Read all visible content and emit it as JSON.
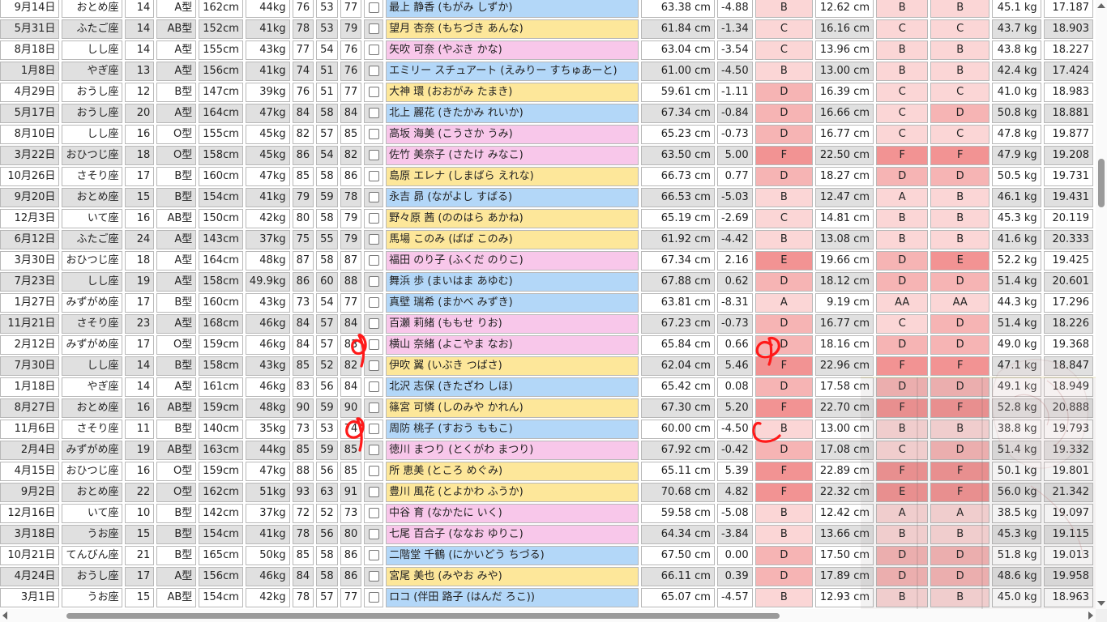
{
  "grid": {
    "rows": [
      {
        "bg": "white",
        "date": "9月14日",
        "sign": "おとめ座",
        "age": "14",
        "blood": "A型",
        "height": "162cm",
        "weight": "44kg",
        "b": "76",
        "w": "53",
        "h": "77",
        "name": "最上 静香 (もがみ しずか)",
        "nc": "blue",
        "len": "63.38 cm",
        "diff": "-4.88",
        "g1": "B",
        "val2": "12.62 cm",
        "g2": "B",
        "g3": "B",
        "kg": "45.1 kg",
        "bmi": "17.187"
      },
      {
        "bg": "gray",
        "date": "5月31日",
        "sign": "ふたご座",
        "age": "14",
        "blood": "AB型",
        "height": "152cm",
        "weight": "41kg",
        "b": "78",
        "w": "53",
        "h": "79",
        "name": "望月 杏奈 (もちづき あんな)",
        "nc": "yellow",
        "len": "61.84 cm",
        "diff": "-1.34",
        "g1": "C",
        "val2": "16.16 cm",
        "g2": "C",
        "g3": "C",
        "kg": "43.7 kg",
        "bmi": "18.903"
      },
      {
        "bg": "white",
        "date": "8月18日",
        "sign": "しし座",
        "age": "14",
        "blood": "A型",
        "height": "155cm",
        "weight": "43kg",
        "b": "77",
        "w": "54",
        "h": "76",
        "name": "矢吹 可奈 (やぶき かな)",
        "nc": "pink",
        "len": "63.04 cm",
        "diff": "-3.54",
        "g1": "C",
        "val2": "13.96 cm",
        "g2": "B",
        "g3": "B",
        "kg": "43.8 kg",
        "bmi": "18.227"
      },
      {
        "bg": "gray",
        "date": "1月8日",
        "sign": "やぎ座",
        "age": "13",
        "blood": "A型",
        "height": "156cm",
        "weight": "41kg",
        "b": "74",
        "w": "51",
        "h": "76",
        "name": "エミリー スチュアート (えみりー すちゅあーと)",
        "nc": "blue",
        "len": "61.00 cm",
        "diff": "-4.50",
        "g1": "B",
        "val2": "13.00 cm",
        "g2": "B",
        "g3": "B",
        "kg": "42.4 kg",
        "bmi": "17.424"
      },
      {
        "bg": "white",
        "date": "4月29日",
        "sign": "おうし座",
        "age": "12",
        "blood": "B型",
        "height": "147cm",
        "weight": "39kg",
        "b": "76",
        "w": "51",
        "h": "77",
        "name": "大神 環 (おおがみ たまき)",
        "nc": "yellow",
        "len": "59.61 cm",
        "diff": "-1.11",
        "g1": "D",
        "val2": "16.39 cm",
        "g2": "C",
        "g3": "C",
        "kg": "41.0 kg",
        "bmi": "18.983"
      },
      {
        "bg": "gray",
        "date": "5月17日",
        "sign": "おうし座",
        "age": "20",
        "blood": "A型",
        "height": "164cm",
        "weight": "47kg",
        "b": "84",
        "w": "58",
        "h": "84",
        "name": "北上 麗花 (きたかみ れいか)",
        "nc": "blue",
        "len": "67.34 cm",
        "diff": "-0.84",
        "g1": "D",
        "val2": "16.66 cm",
        "g2": "C",
        "g3": "D",
        "kg": "50.8 kg",
        "bmi": "18.881"
      },
      {
        "bg": "white",
        "date": "8月10日",
        "sign": "しし座",
        "age": "16",
        "blood": "O型",
        "height": "155cm",
        "weight": "45kg",
        "b": "82",
        "w": "57",
        "h": "85",
        "name": "高坂 海美 (こうさか うみ)",
        "nc": "pink",
        "len": "65.23 cm",
        "diff": "-0.73",
        "g1": "D",
        "val2": "16.77 cm",
        "g2": "C",
        "g3": "C",
        "kg": "47.8 kg",
        "bmi": "19.877"
      },
      {
        "bg": "gray",
        "date": "3月22日",
        "sign": "おひつじ座",
        "age": "18",
        "blood": "O型",
        "height": "158cm",
        "weight": "45kg",
        "b": "86",
        "w": "54",
        "h": "82",
        "name": "佐竹 美奈子 (さたけ みなこ)",
        "nc": "pink",
        "len": "63.50 cm",
        "diff": "5.00",
        "g1": "F",
        "val2": "22.50 cm",
        "g2": "F",
        "g3": "F",
        "kg": "47.9 kg",
        "bmi": "19.208"
      },
      {
        "bg": "white",
        "date": "10月26日",
        "sign": "さそり座",
        "age": "17",
        "blood": "B型",
        "height": "160cm",
        "weight": "47kg",
        "b": "85",
        "w": "58",
        "h": "86",
        "name": "島原 エレナ (しまばら えれな)",
        "nc": "yellow",
        "len": "66.73 cm",
        "diff": "0.77",
        "g1": "D",
        "val2": "18.27 cm",
        "g2": "D",
        "g3": "D",
        "kg": "50.5 kg",
        "bmi": "19.731"
      },
      {
        "bg": "gray",
        "date": "9月20日",
        "sign": "おとめ座",
        "age": "15",
        "blood": "B型",
        "height": "154cm",
        "weight": "41kg",
        "b": "79",
        "w": "59",
        "h": "78",
        "name": "永吉 昴 (ながよし すばる)",
        "nc": "blue",
        "len": "66.53 cm",
        "diff": "-5.03",
        "g1": "B",
        "val2": "12.47 cm",
        "g2": "A",
        "g3": "B",
        "kg": "46.1 kg",
        "bmi": "19.431"
      },
      {
        "bg": "white",
        "date": "12月3日",
        "sign": "いて座",
        "age": "16",
        "blood": "AB型",
        "height": "150cm",
        "weight": "42kg",
        "b": "80",
        "w": "58",
        "h": "79",
        "name": "野々原 茜 (ののはら あかね)",
        "nc": "yellow",
        "len": "65.19 cm",
        "diff": "-2.69",
        "g1": "C",
        "val2": "14.81 cm",
        "g2": "B",
        "g3": "B",
        "kg": "45.3 kg",
        "bmi": "20.119"
      },
      {
        "bg": "gray",
        "date": "6月12日",
        "sign": "ふたご座",
        "age": "24",
        "blood": "A型",
        "height": "143cm",
        "weight": "37kg",
        "b": "75",
        "w": "55",
        "h": "79",
        "name": "馬場 このみ (ばば このみ)",
        "nc": "yellow",
        "len": "61.92 cm",
        "diff": "-4.42",
        "g1": "B",
        "val2": "13.08 cm",
        "g2": "B",
        "g3": "B",
        "kg": "41.6 kg",
        "bmi": "20.333"
      },
      {
        "bg": "white",
        "date": "3月30日",
        "sign": "おひつじ座",
        "age": "18",
        "blood": "A型",
        "height": "164cm",
        "weight": "48kg",
        "b": "87",
        "w": "58",
        "h": "87",
        "name": "福田 のり子 (ふくだ のりこ)",
        "nc": "pink",
        "len": "67.34 cm",
        "diff": "2.16",
        "g1": "E",
        "val2": "19.66 cm",
        "g2": "D",
        "g3": "E",
        "kg": "52.2 kg",
        "bmi": "19.425"
      },
      {
        "bg": "gray",
        "date": "7月23日",
        "sign": "しし座",
        "age": "19",
        "blood": "A型",
        "height": "158cm",
        "weight": "49.9kg",
        "b": "86",
        "w": "60",
        "h": "88",
        "name": "舞浜 歩 (まいはま あゆむ)",
        "nc": "blue",
        "len": "67.88 cm",
        "diff": "0.62",
        "g1": "D",
        "val2": "18.12 cm",
        "g2": "D",
        "g3": "D",
        "kg": "51.4 kg",
        "bmi": "20.601"
      },
      {
        "bg": "white",
        "date": "1月27日",
        "sign": "みずがめ座",
        "age": "17",
        "blood": "B型",
        "height": "160cm",
        "weight": "43kg",
        "b": "73",
        "w": "54",
        "h": "77",
        "name": "真壁 瑞希 (まかべ みずき)",
        "nc": "blue",
        "len": "63.81 cm",
        "diff": "-8.31",
        "g1": "A",
        "val2": "9.19 cm",
        "g2": "AA",
        "g3": "AA",
        "kg": "44.3 kg",
        "bmi": "17.296"
      },
      {
        "bg": "gray",
        "date": "11月21日",
        "sign": "さそり座",
        "age": "23",
        "blood": "A型",
        "height": "168cm",
        "weight": "46kg",
        "b": "84",
        "w": "57",
        "h": "84",
        "name": "百瀬 莉緒 (ももせ りお)",
        "nc": "pink",
        "len": "67.23 cm",
        "diff": "-0.73",
        "g1": "D",
        "val2": "16.77 cm",
        "g2": "C",
        "g3": "D",
        "kg": "51.4 kg",
        "bmi": "18.226"
      },
      {
        "bg": "white",
        "date": "2月12日",
        "sign": "みずがめ座",
        "age": "17",
        "blood": "O型",
        "height": "159cm",
        "weight": "46kg",
        "b": "84",
        "w": "57",
        "h": "83",
        "name": "横山 奈緒 (よこやま なお)",
        "nc": "pink",
        "len": "65.84 cm",
        "diff": "0.66",
        "g1": "D",
        "val2": "18.16 cm",
        "g2": "D",
        "g3": "D",
        "kg": "49.0 kg",
        "bmi": "19.368"
      },
      {
        "bg": "gray",
        "date": "7月30日",
        "sign": "しし座",
        "age": "14",
        "blood": "B型",
        "height": "158cm",
        "weight": "43kg",
        "b": "85",
        "w": "52",
        "h": "82",
        "name": "伊吹 翼 (いぶき つばさ)",
        "nc": "yellow",
        "len": "62.04 cm",
        "diff": "5.46",
        "g1": "F",
        "val2": "22.96 cm",
        "g2": "F",
        "g3": "F",
        "kg": "47.1 kg",
        "bmi": "18.847"
      },
      {
        "bg": "white",
        "date": "1月18日",
        "sign": "やぎ座",
        "age": "14",
        "blood": "A型",
        "height": "161cm",
        "weight": "46kg",
        "b": "83",
        "w": "56",
        "h": "84",
        "name": "北沢 志保 (きたざわ しほ)",
        "nc": "blue",
        "len": "65.42 cm",
        "diff": "0.08",
        "g1": "D",
        "val2": "17.58 cm",
        "g2": "D",
        "g3": "D",
        "kg": "49.1 kg",
        "bmi": "18.949"
      },
      {
        "bg": "gray",
        "date": "8月27日",
        "sign": "おとめ座",
        "age": "16",
        "blood": "AB型",
        "height": "159cm",
        "weight": "48kg",
        "b": "90",
        "w": "59",
        "h": "90",
        "name": "篠宮 可憐 (しのみや かれん)",
        "nc": "yellow",
        "len": "67.30 cm",
        "diff": "5.20",
        "g1": "F",
        "val2": "22.70 cm",
        "g2": "F",
        "g3": "F",
        "kg": "52.8 kg",
        "bmi": "20.888"
      },
      {
        "bg": "white",
        "date": "11月6日",
        "sign": "さそり座",
        "age": "11",
        "blood": "B型",
        "height": "140cm",
        "weight": "35kg",
        "b": "73",
        "w": "53",
        "h": "74",
        "name": "周防 桃子 (すおう ももこ)",
        "nc": "blue",
        "len": "60.00 cm",
        "diff": "-4.50",
        "g1": "B",
        "val2": "13.00 cm",
        "g2": "B",
        "g3": "B",
        "kg": "38.8 kg",
        "bmi": "19.793"
      },
      {
        "bg": "gray",
        "date": "2月4日",
        "sign": "みずがめ座",
        "age": "19",
        "blood": "AB型",
        "height": "163cm",
        "weight": "44kg",
        "b": "85",
        "w": "59",
        "h": "85",
        "name": "徳川 まつり (とくがわ まつり)",
        "nc": "pink",
        "len": "67.92 cm",
        "diff": "-0.42",
        "g1": "D",
        "val2": "17.08 cm",
        "g2": "C",
        "g3": "D",
        "kg": "51.4 kg",
        "bmi": "19.332"
      },
      {
        "bg": "white",
        "date": "4月15日",
        "sign": "おひつじ座",
        "age": "16",
        "blood": "O型",
        "height": "159cm",
        "weight": "47kg",
        "b": "88",
        "w": "56",
        "h": "85",
        "name": "所 恵美 (ところ めぐみ)",
        "nc": "yellow",
        "len": "65.11 cm",
        "diff": "5.39",
        "g1": "F",
        "val2": "22.89 cm",
        "g2": "F",
        "g3": "F",
        "kg": "50.1 kg",
        "bmi": "19.801"
      },
      {
        "bg": "gray",
        "date": "9月2日",
        "sign": "おとめ座",
        "age": "22",
        "blood": "O型",
        "height": "162cm",
        "weight": "51kg",
        "b": "93",
        "w": "63",
        "h": "91",
        "name": "豊川 風花 (とよかわ ふうか)",
        "nc": "yellow",
        "len": "70.68 cm",
        "diff": "4.82",
        "g1": "F",
        "val2": "22.32 cm",
        "g2": "E",
        "g3": "F",
        "kg": "56.0 kg",
        "bmi": "21.342"
      },
      {
        "bg": "white",
        "date": "12月16日",
        "sign": "いて座",
        "age": "10",
        "blood": "B型",
        "height": "142cm",
        "weight": "37kg",
        "b": "72",
        "w": "52",
        "h": "73",
        "name": "中谷 育 (なかたに いく)",
        "nc": "pink",
        "len": "59.58 cm",
        "diff": "-5.08",
        "g1": "B",
        "val2": "12.42 cm",
        "g2": "A",
        "g3": "A",
        "kg": "38.5 kg",
        "bmi": "19.097"
      },
      {
        "bg": "gray",
        "date": "3月18日",
        "sign": "うお座",
        "age": "15",
        "blood": "B型",
        "height": "154cm",
        "weight": "41kg",
        "b": "78",
        "w": "56",
        "h": "80",
        "name": "七尾 百合子 (ななお ゆりこ)",
        "nc": "pink",
        "len": "64.34 cm",
        "diff": "-3.84",
        "g1": "B",
        "val2": "13.66 cm",
        "g2": "B",
        "g3": "B",
        "kg": "45.3 kg",
        "bmi": "19.115"
      },
      {
        "bg": "white",
        "date": "10月21日",
        "sign": "てんびん座",
        "age": "21",
        "blood": "B型",
        "height": "165cm",
        "weight": "50kg",
        "b": "85",
        "w": "58",
        "h": "86",
        "name": "二階堂 千鶴 (にかいどう ちづる)",
        "nc": "blue",
        "len": "67.50 cm",
        "diff": "0.00",
        "g1": "D",
        "val2": "17.50 cm",
        "g2": "D",
        "g3": "D",
        "kg": "51.8 kg",
        "bmi": "19.013"
      },
      {
        "bg": "gray",
        "date": "4月24日",
        "sign": "おうし座",
        "age": "17",
        "blood": "A型",
        "height": "156cm",
        "weight": "46kg",
        "b": "84",
        "w": "58",
        "h": "86",
        "name": "宮尾 美也 (みやお みや)",
        "nc": "yellow",
        "len": "66.11 cm",
        "diff": "0.39",
        "g1": "D",
        "val2": "17.89 cm",
        "g2": "D",
        "g3": "D",
        "kg": "48.6 kg",
        "bmi": "19.958"
      },
      {
        "bg": "white",
        "date": "3月1日",
        "sign": "うお座",
        "age": "15",
        "blood": "AB型",
        "height": "154cm",
        "weight": "42kg",
        "b": "78",
        "w": "57",
        "h": "77",
        "name": "ロコ (伴田 路子 (はんだ ろこ))",
        "nc": "blue",
        "len": "65.07 cm",
        "diff": "-4.57",
        "g1": "B",
        "val2": "12.93 cm",
        "g2": "B",
        "g3": "B",
        "kg": "45.0 kg",
        "bmi": "18.963"
      }
    ]
  },
  "colors": {
    "name_blue": "#b3d7f8",
    "name_yellow": "#fde79a",
    "name_pink": "#f8c7ea",
    "grade_light": "#fbd6d6",
    "grade_mid": "#f6b4b4",
    "grade_dark": "#f29393",
    "row_gray": "#e0e0e0",
    "annotation_red": "#ff1a1a"
  },
  "icons": {
    "checkbox": "checkbox-icon",
    "scroll_up": "scroll-up-arrow-icon",
    "scroll_down": "scroll-down-arrow-icon",
    "scroll_left": "scroll-left-arrow-icon",
    "scroll_right": "scroll-right-arrow-icon"
  }
}
